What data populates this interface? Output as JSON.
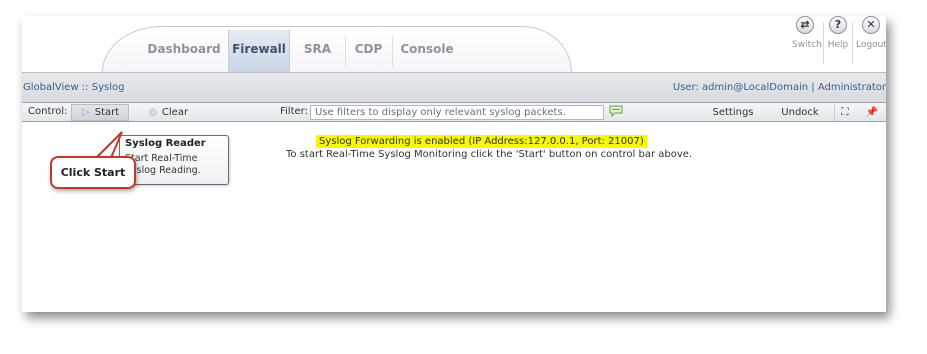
{
  "nav": {
    "tabs": [
      {
        "label": "Dashboard",
        "active": false
      },
      {
        "label": "Firewall",
        "active": true
      },
      {
        "label": "SRA",
        "active": false
      },
      {
        "label": "CDP",
        "active": false
      },
      {
        "label": "Console",
        "active": false
      }
    ],
    "actions": [
      {
        "label": "Switch",
        "icon": "switch-icon"
      },
      {
        "label": "Help",
        "icon": "help-icon"
      },
      {
        "label": "Logout",
        "icon": "logout-icon"
      }
    ]
  },
  "breadcrumb": "GlobalView :: Syslog",
  "user_info": "User: admin@LocalDomain | Administrator",
  "control_bar": {
    "control_label": "Control:",
    "start_label": "Start",
    "clear_label": "Clear",
    "filter_label": "Filter:",
    "filter_placeholder": "Use filters to display only relevant syslog packets.",
    "settings_label": "Settings",
    "undock_label": "Undock"
  },
  "content": {
    "forwarding_status": "Syslog Forwarding is enabled (IP Address:127.0.0.1, Port: 21007)",
    "hint": "To start Real-Time Syslog Monitoring click the 'Start' button on control bar above."
  },
  "tooltip": {
    "title": "Syslog Reader",
    "body": "Start Real-Time Syslog Reading."
  },
  "callout": "Click Start",
  "colors": {
    "highlight": "#f7f70a",
    "callout_border": "#c0392b",
    "active_tab": "#c9d4e6",
    "link_text": "#3f5f8a"
  }
}
